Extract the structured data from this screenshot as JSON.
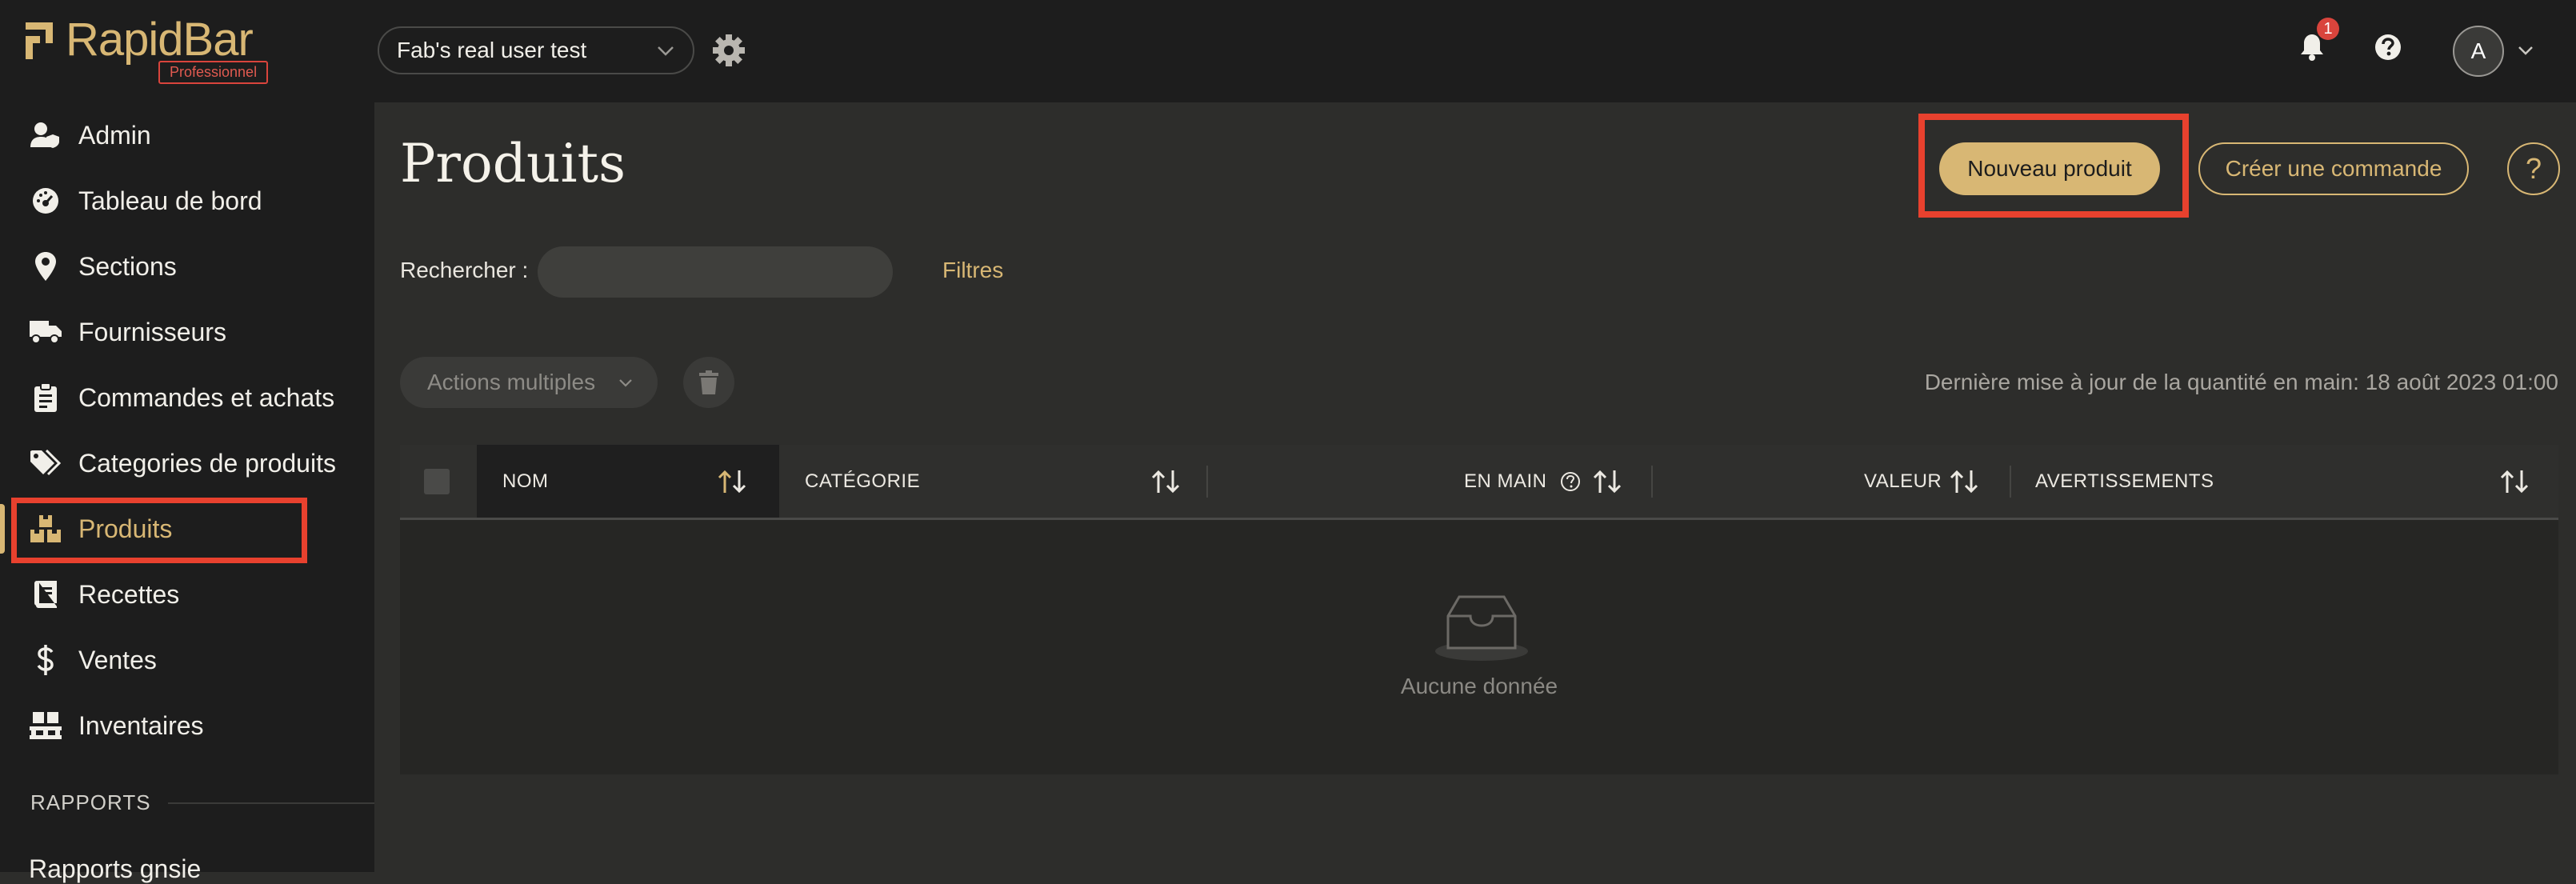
{
  "brand": {
    "name": "RapidBar",
    "badge": "Professionnel",
    "color": "#d8b774"
  },
  "header": {
    "workspace": "Fab's real user test",
    "notifications_count": "1",
    "avatar_initial": "A"
  },
  "sidebar": {
    "items": [
      {
        "label": "Admin",
        "icon": "user-shield-icon"
      },
      {
        "label": "Tableau de bord",
        "icon": "dashboard-gauge-icon"
      },
      {
        "label": "Sections",
        "icon": "map-pin-icon"
      },
      {
        "label": "Fournisseurs",
        "icon": "truck-icon"
      },
      {
        "label": "Commandes et achats",
        "icon": "clipboard-icon"
      },
      {
        "label": "Categories de produits",
        "icon": "tags-icon"
      },
      {
        "label": "Produits",
        "icon": "boxes-icon",
        "active": true
      },
      {
        "label": "Recettes",
        "icon": "book-icon"
      },
      {
        "label": "Ventes",
        "icon": "dollar-icon"
      },
      {
        "label": "Inventaires",
        "icon": "pallet-icon"
      }
    ],
    "section_label": "RAPPORTS",
    "truncated_item": "Rapports gnsie"
  },
  "main": {
    "title": "Produits",
    "new_product": "Nouveau produit",
    "create_order": "Créer une commande",
    "help_label": "?",
    "search_label": "Rechercher :",
    "search_value": "",
    "filters": "Filtres",
    "bulk_actions": "Actions multiples",
    "last_update": "Dernière mise à jour de la quantité en main: 18 août 2023 01:00"
  },
  "table": {
    "columns": [
      "NOM",
      "CATÉGORIE",
      "EN MAIN",
      "VALEUR",
      "AVERTISSEMENTS"
    ],
    "rows": [],
    "empty_text": "Aucune donnée"
  },
  "colors": {
    "accent": "#d8b774",
    "highlight": "#e8412e",
    "sidebar_bg": "#1d1d1d",
    "content_bg": "#2d2d2b"
  }
}
